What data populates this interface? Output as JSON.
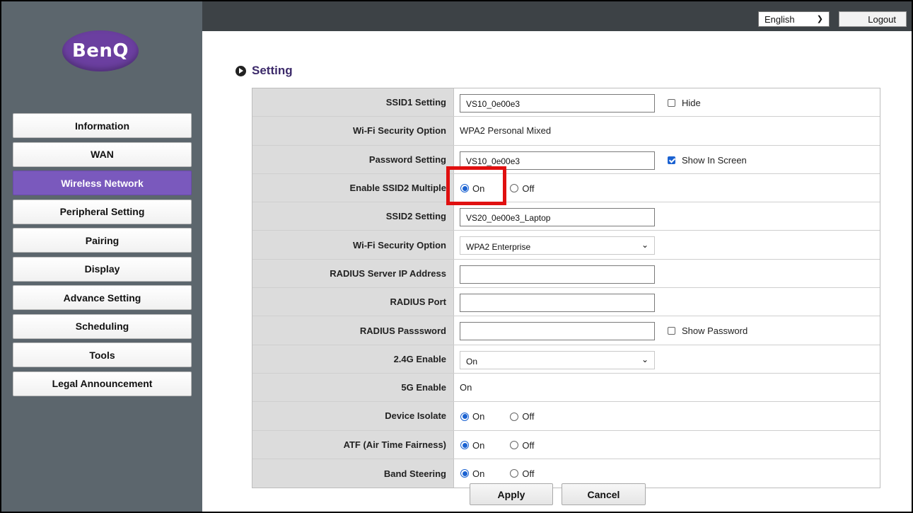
{
  "header": {
    "language": "English",
    "logout_label": "Logout"
  },
  "brand": {
    "logo_text": "BenQ"
  },
  "sidebar": {
    "items": [
      {
        "label": "Information",
        "active": false
      },
      {
        "label": "WAN",
        "active": false
      },
      {
        "label": "Wireless Network",
        "active": true
      },
      {
        "label": "Peripheral Setting",
        "active": false
      },
      {
        "label": "Pairing",
        "active": false
      },
      {
        "label": "Display",
        "active": false
      },
      {
        "label": "Advance Setting",
        "active": false
      },
      {
        "label": "Scheduling",
        "active": false
      },
      {
        "label": "Tools",
        "active": false
      },
      {
        "label": "Legal Announcement",
        "active": false
      }
    ]
  },
  "page": {
    "title": "Setting"
  },
  "settings": {
    "ssid1": {
      "label": "SSID1 Setting",
      "value": "VS10_0e00e3",
      "hide_label": "Hide",
      "hide_checked": false
    },
    "wifi_security_1": {
      "label": "Wi-Fi Security Option",
      "value": "WPA2 Personal Mixed"
    },
    "password": {
      "label": "Password Setting",
      "value": "VS10_0e00e3",
      "show_label": "Show In Screen",
      "show_checked": true
    },
    "enable_ssid2": {
      "label": "Enable SSID2 Multiple",
      "on_label": "On",
      "off_label": "Off",
      "selected": "On"
    },
    "ssid2": {
      "label": "SSID2 Setting",
      "value": "VS20_0e00e3_Laptop"
    },
    "wifi_security_2": {
      "label": "Wi-Fi Security Option",
      "value": "WPA2 Enterprise"
    },
    "radius_ip": {
      "label": "RADIUS Server IP Address",
      "value": ""
    },
    "radius_port": {
      "label": "RADIUS Port",
      "value": ""
    },
    "radius_password": {
      "label": "RADIUS Passsword",
      "value": "",
      "show_label": "Show Password",
      "show_checked": false
    },
    "enable_24g": {
      "label": "2.4G Enable",
      "value": "On"
    },
    "enable_5g": {
      "label": "5G Enable",
      "value": "On"
    },
    "device_isolate": {
      "label": "Device Isolate",
      "on_label": "On",
      "off_label": "Off",
      "selected": "On"
    },
    "atf": {
      "label": "ATF (Air Time Fairness)",
      "on_label": "On",
      "off_label": "Off",
      "selected": "On"
    },
    "band_steering": {
      "label": "Band Steering",
      "on_label": "On",
      "off_label": "Off",
      "selected": "On"
    }
  },
  "actions": {
    "apply_label": "Apply",
    "cancel_label": "Cancel"
  },
  "colors": {
    "sidebar_bg": "#5c666d",
    "topbar_bg": "#3d4246",
    "active_nav": "#7a59bd",
    "highlight": "#e01010",
    "radio_blue": "#1b62d1"
  }
}
